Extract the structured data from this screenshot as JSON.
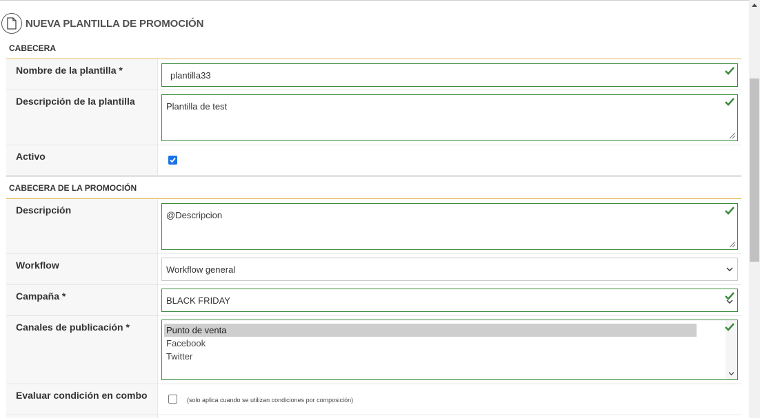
{
  "page": {
    "title": "NUEVA PLANTILLA DE PROMOCIÓN"
  },
  "sections": {
    "cabecera": "CABECERA",
    "promocion": "CABECERA DE LA PROMOCIÓN"
  },
  "cabecera": {
    "nombre_label": "Nombre de la plantilla *",
    "nombre_value": "plantilla33",
    "descripcion_label": "Descripción de la plantilla",
    "descripcion_value": "Plantilla de test",
    "activo_label": "Activo",
    "activo_checked": true
  },
  "promocion": {
    "descripcion_label": "Descripción",
    "descripcion_value": "@Descripcion",
    "workflow_label": "Workflow",
    "workflow_value": "Workflow general",
    "campana_label": "Campaña *",
    "campana_value": "BLACK FRIDAY",
    "canales_label": "Canales de publicación *",
    "canales_options": [
      "Punto de venta",
      "Facebook",
      "Twitter"
    ],
    "canales_selected": "Punto de venta",
    "evaluar_label": "Evaluar condición en combo",
    "evaluar_checked": false,
    "evaluar_hint": "(solo aplica cuando se utilizan condiciones por composición)"
  },
  "colors": {
    "valid_border": "#3c8a3c",
    "section_underline": "#e5b95a",
    "checkbox_accent": "#1a73e8"
  },
  "icons": {
    "title": "document-icon",
    "valid": "check-icon",
    "select": "chevron-down-icon"
  }
}
